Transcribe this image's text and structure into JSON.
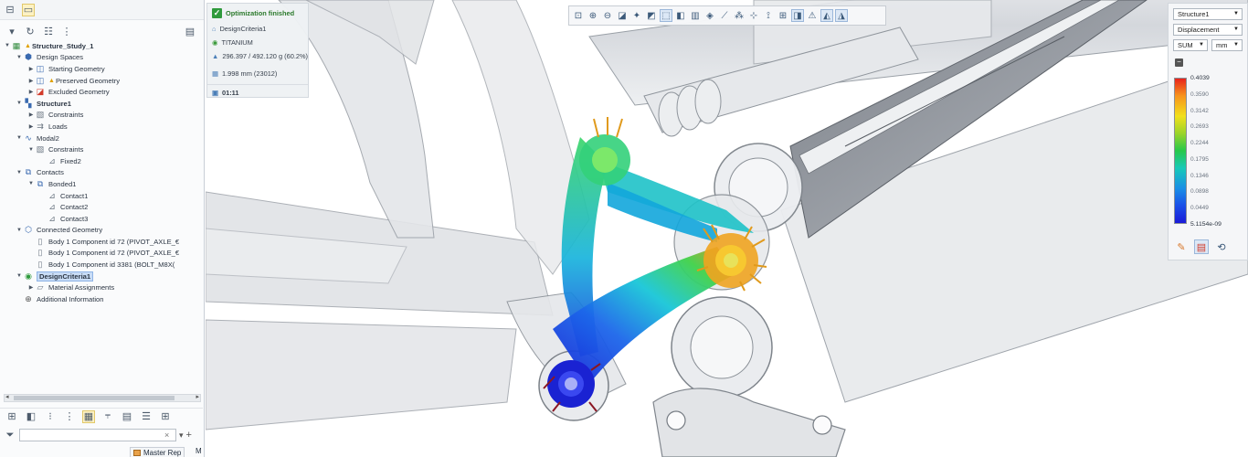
{
  "tree": {
    "items": [
      {
        "depth": 0,
        "twisty": "▼",
        "icon": "study-icon",
        "label": "Structure_Study_1",
        "warn": true,
        "bold": true
      },
      {
        "depth": 1,
        "twisty": "▼",
        "icon": "design-spaces-icon",
        "label": "Design Spaces"
      },
      {
        "depth": 2,
        "twisty": "▶",
        "icon": "geometry-icon",
        "label": "Starting Geometry"
      },
      {
        "depth": 2,
        "twisty": "▶",
        "icon": "geometry-icon",
        "label": "Preserved Geometry",
        "warn": true
      },
      {
        "depth": 2,
        "twisty": "▶",
        "icon": "excluded-geometry-icon",
        "label": "Excluded Geometry"
      },
      {
        "depth": 1,
        "twisty": "▼",
        "icon": "structure-icon",
        "label": "Structure1",
        "bold": true
      },
      {
        "depth": 2,
        "twisty": "▶",
        "icon": "constraints-icon",
        "label": "Constraints"
      },
      {
        "depth": 2,
        "twisty": "▶",
        "icon": "loads-icon",
        "label": "Loads"
      },
      {
        "depth": 1,
        "twisty": "▼",
        "icon": "modal-icon",
        "label": "Modal2"
      },
      {
        "depth": 2,
        "twisty": "▼",
        "icon": "constraints-icon",
        "label": "Constraints"
      },
      {
        "depth": 3,
        "twisty": "",
        "icon": "fixed-icon",
        "label": "Fixed2"
      },
      {
        "depth": 1,
        "twisty": "▼",
        "icon": "contacts-icon",
        "label": "Contacts"
      },
      {
        "depth": 2,
        "twisty": "▼",
        "icon": "bonded-icon",
        "label": "Bonded1"
      },
      {
        "depth": 3,
        "twisty": "",
        "icon": "contact-icon",
        "label": "Contact1"
      },
      {
        "depth": 3,
        "twisty": "",
        "icon": "contact-icon",
        "label": "Contact2"
      },
      {
        "depth": 3,
        "twisty": "",
        "icon": "contact-icon",
        "label": "Contact3"
      },
      {
        "depth": 1,
        "twisty": "▼",
        "icon": "connected-geometry-icon",
        "label": "Connected Geometry"
      },
      {
        "depth": 2,
        "twisty": "",
        "icon": "body-icon",
        "label": "Body 1 Component id 72 (PIVOT_AXLE_€"
      },
      {
        "depth": 2,
        "twisty": "",
        "icon": "body-icon",
        "label": "Body 1 Component id 72 (PIVOT_AXLE_€"
      },
      {
        "depth": 2,
        "twisty": "",
        "icon": "body-icon",
        "label": "Body 1 Component id 3381 (BOLT_M8X("
      },
      {
        "depth": 1,
        "twisty": "▼",
        "icon": "design-criteria-icon",
        "label": "DesignCriteria1",
        "selected": true
      },
      {
        "depth": 2,
        "twisty": "▶",
        "icon": "material-icon",
        "label": "Material Assignments"
      },
      {
        "depth": 1,
        "twisty": "",
        "icon": "add-icon",
        "label": "Additional Information"
      }
    ]
  },
  "filter": {
    "value": "",
    "clear": "×",
    "dropdown": "▾",
    "add": "+"
  },
  "status_tab": {
    "label": "Master Rep",
    "extra": "M"
  },
  "info": {
    "title": "Optimization finished",
    "criteria": "DesignCriteria1",
    "material": "TITANIUM",
    "mass": "296.397 / 492.120 g (60.2%)",
    "size": "1.998 mm (23012)",
    "time": "01:11"
  },
  "legend": {
    "structure_select": "Structure1",
    "result_select": "Displacement",
    "component_select": "SUM",
    "unit_select": "mm",
    "collapse": "−",
    "ticks": [
      "0.4039",
      "0.3590",
      "0.3142",
      "0.2693",
      "0.2244",
      "0.1795",
      "0.1346",
      "0.0898",
      "0.0449",
      "5.1154e-09"
    ]
  },
  "colors": {
    "accent": "#2f9a3c",
    "selection": "#c8dcf5",
    "legend_max": "#e8231c",
    "legend_min": "#1a1ad8"
  }
}
